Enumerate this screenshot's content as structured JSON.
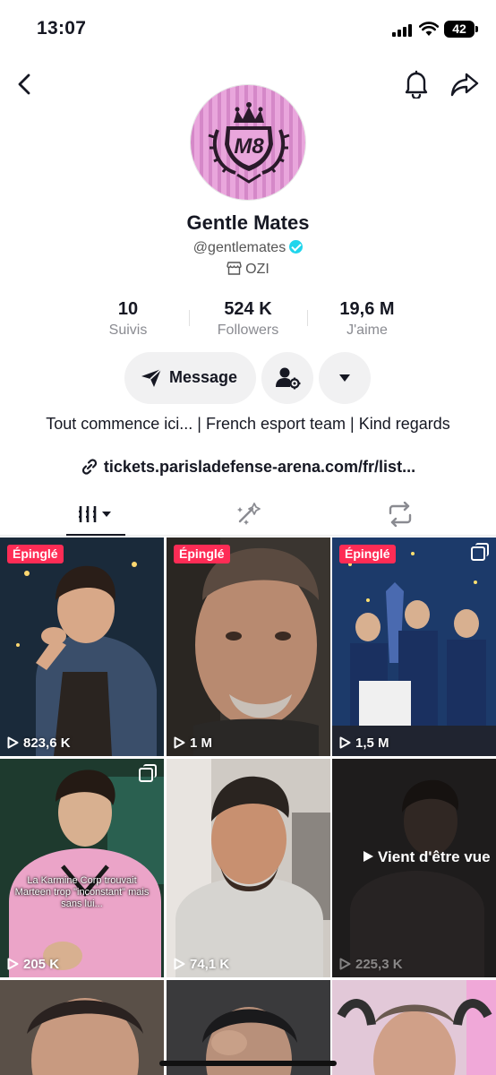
{
  "status_bar": {
    "time": "13:07",
    "battery": "42"
  },
  "profile": {
    "name": "Gentle Mates",
    "handle": "@gentlemates",
    "shop_label": "OZI",
    "avatar_text": "M8"
  },
  "stats": [
    {
      "value": "10",
      "label": "Suivis"
    },
    {
      "value": "524 K",
      "label": "Followers"
    },
    {
      "value": "19,6 M",
      "label": "J'aime"
    }
  ],
  "actions": {
    "message_label": "Message"
  },
  "bio": "Tout commence ici... | French esport team | Kind regards",
  "link": "tickets.parisladefense-arena.com/fr/list...",
  "videos": [
    {
      "pinned": "Épinglé",
      "views": "823,6 K"
    },
    {
      "pinned": "Épinglé",
      "views": "1 M"
    },
    {
      "pinned": "Épinglé",
      "views": "1,5 M"
    },
    {
      "views": "205 K",
      "caption": "La Karmine Corp trouvait Marteen trop \"inconstant\" mais sans lui..."
    },
    {
      "views": "74,1 K"
    },
    {
      "views": "225,3 K",
      "overlay": "Vient d'être vue"
    }
  ],
  "colors": {
    "pin": "#fe2c55",
    "verified": "#20d5ec",
    "avatar_bg": "#e9a6dc"
  }
}
